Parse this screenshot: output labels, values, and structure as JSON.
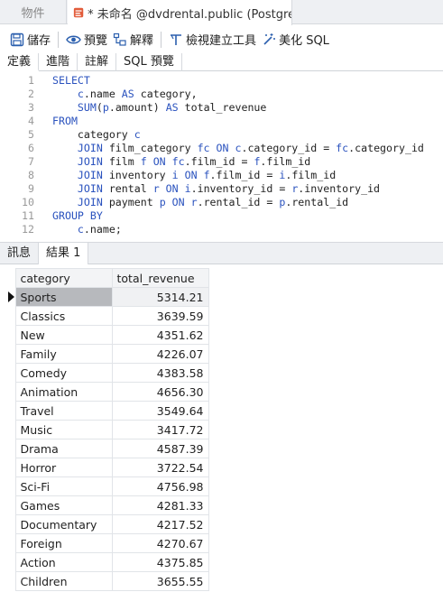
{
  "tabs": {
    "objects_label": "物件",
    "query_label": "* 未命名 @dvdrental.public (PostgreSQ..."
  },
  "toolbar": {
    "save_label": "儲存",
    "preview_label": "預覽",
    "explain_label": "解釋",
    "query_builder_label": "檢視建立工具",
    "beautify_label": "美化 SQL"
  },
  "subtabs": [
    "定義",
    "進階",
    "註解",
    "SQL 預覽"
  ],
  "editor": {
    "lines": [
      "SELECT",
      "    c.name AS category,",
      "    SUM(p.amount) AS total_revenue",
      "FROM",
      "    category c",
      "    JOIN film_category fc ON c.category_id = fc.category_id",
      "    JOIN film f ON fc.film_id = f.film_id",
      "    JOIN inventory i ON f.film_id = i.film_id",
      "    JOIN rental r ON i.inventory_id = r.inventory_id",
      "    JOIN payment p ON r.rental_id = p.rental_id",
      "GROUP BY",
      "    c.name;"
    ]
  },
  "result_tabs": [
    "訊息",
    "結果 1"
  ],
  "grid": {
    "columns": [
      "category",
      "total_revenue"
    ],
    "rows": [
      [
        "Sports",
        "5314.21"
      ],
      [
        "Classics",
        "3639.59"
      ],
      [
        "New",
        "4351.62"
      ],
      [
        "Family",
        "4226.07"
      ],
      [
        "Comedy",
        "4383.58"
      ],
      [
        "Animation",
        "4656.30"
      ],
      [
        "Travel",
        "3549.64"
      ],
      [
        "Music",
        "3417.72"
      ],
      [
        "Drama",
        "4587.39"
      ],
      [
        "Horror",
        "3722.54"
      ],
      [
        "Sci-Fi",
        "4756.98"
      ],
      [
        "Games",
        "4281.33"
      ],
      [
        "Documentary",
        "4217.52"
      ],
      [
        "Foreign",
        "4270.67"
      ],
      [
        "Action",
        "4375.85"
      ],
      [
        "Children",
        "3655.55"
      ]
    ]
  },
  "colors": {
    "keyword": "#2a52be",
    "selected_cell": "#b7b9bd"
  }
}
